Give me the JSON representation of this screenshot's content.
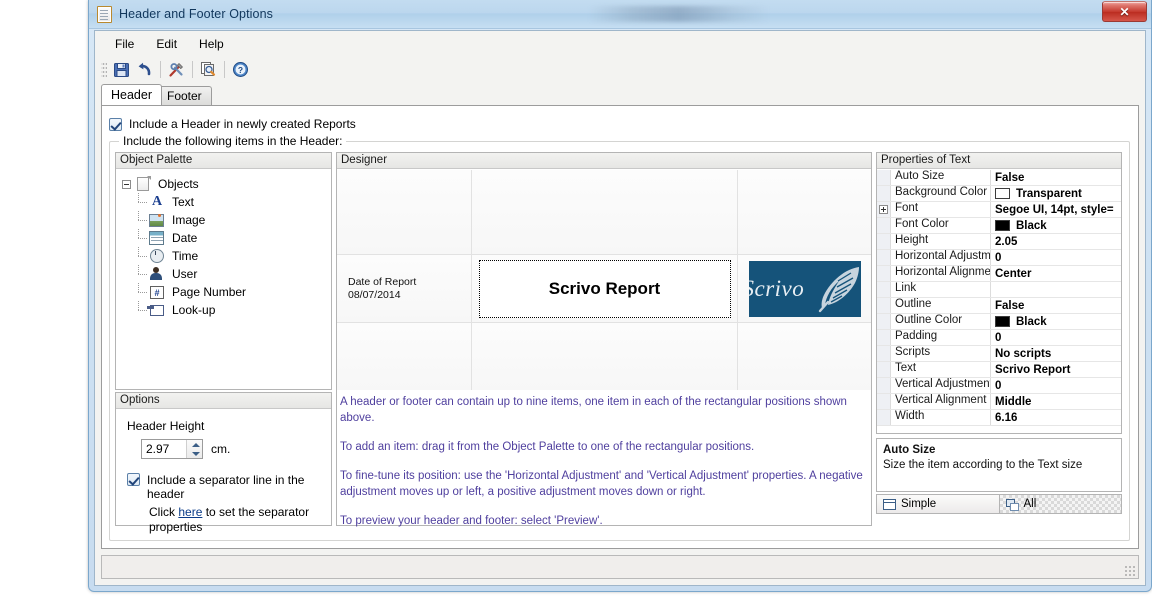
{
  "window": {
    "title": "Header and Footer Options",
    "icon": "document-icon",
    "close_label": "✕"
  },
  "menu": {
    "items": [
      {
        "label": "File"
      },
      {
        "label": "Edit"
      },
      {
        "label": "Help"
      }
    ]
  },
  "toolbar": {
    "buttons": [
      {
        "name": "save-button",
        "icon": "save-icon"
      },
      {
        "name": "undo-button",
        "icon": "undo-icon"
      },
      {
        "name": "tools-button",
        "icon": "tools-icon"
      },
      {
        "name": "preview-button",
        "icon": "preview-icon"
      },
      {
        "name": "help-button",
        "icon": "help-icon"
      }
    ]
  },
  "tabs": [
    {
      "label": "Header",
      "active": true
    },
    {
      "label": "Footer",
      "active": false
    }
  ],
  "content": {
    "include_header_checkbox": {
      "label": "Include a Header in newly created Reports",
      "checked": true
    },
    "group_title": "Include the following items in the Header:"
  },
  "palette": {
    "title": "Object Palette",
    "root": {
      "label": "Objects",
      "icon": "document-icon",
      "expanded": true
    },
    "items": [
      {
        "label": "Text",
        "icon": "text-icon"
      },
      {
        "label": "Image",
        "icon": "image-icon"
      },
      {
        "label": "Date",
        "icon": "date-icon"
      },
      {
        "label": "Time",
        "icon": "time-icon"
      },
      {
        "label": "User",
        "icon": "user-icon"
      },
      {
        "label": "Page Number",
        "icon": "page-number-icon"
      },
      {
        "label": "Look-up",
        "icon": "look-up-icon"
      }
    ]
  },
  "options": {
    "title": "Options",
    "header_height_label": "Header Height",
    "header_height_value": "2.97",
    "header_height_unit": "cm.",
    "separator_checkbox": {
      "label": "Include a separator line in the header",
      "checked": true
    },
    "separator_link_prefix": "Click ",
    "separator_link_text": "here",
    "separator_link_suffix": " to set the separator properties"
  },
  "designer": {
    "title": "Designer",
    "cells": {
      "date_label": "Date of Report",
      "date_value": "08/07/2014",
      "title_text": "Scrivo Report",
      "logo_text": "Scrivo",
      "logo_color": "#15537a",
      "logo_icon": "quill-icon"
    },
    "help": [
      "A header or footer can contain up to nine items, one item in each of the rectangular positions shown above.",
      "To add an item: drag it from the Object Palette to one of the rectangular positions.",
      "To fine-tune its position: use the 'Horizontal Adjustment' and 'Vertical Adjustment' properties. A negative adjustment moves up or left, a positive adjustment moves down or right.",
      "To preview your header and footer: select 'Preview'."
    ],
    "help_color": "#4f3f9e"
  },
  "properties": {
    "title": "Properties of Text",
    "rows": [
      {
        "name": "Auto Size",
        "value": "False",
        "expandable": false
      },
      {
        "name": "Background Color",
        "value": "Transparent",
        "swatch": "#ffffff",
        "expandable": false
      },
      {
        "name": "Font",
        "value": "Segoe UI, 14pt, style=",
        "expandable": true
      },
      {
        "name": "Font Color",
        "value": "Black",
        "swatch": "#000000",
        "expandable": false
      },
      {
        "name": "Height",
        "value": "2.05",
        "expandable": false
      },
      {
        "name": "Horizontal Adjustme",
        "value": "0",
        "expandable": false
      },
      {
        "name": "Horizontal Alignmen",
        "value": "Center",
        "expandable": false
      },
      {
        "name": "Link",
        "value": "",
        "expandable": false
      },
      {
        "name": "Outline",
        "value": "False",
        "expandable": false
      },
      {
        "name": "Outline Color",
        "value": "Black",
        "swatch": "#000000",
        "expandable": false
      },
      {
        "name": "Padding",
        "value": "0",
        "expandable": false
      },
      {
        "name": "Scripts",
        "value": "No scripts",
        "expandable": false
      },
      {
        "name": "Text",
        "value": "Scrivo Report",
        "expandable": false
      },
      {
        "name": "Vertical Adjustment",
        "value": "0",
        "expandable": false
      },
      {
        "name": "Vertical Alignment",
        "value": "Middle",
        "expandable": false
      },
      {
        "name": "Width",
        "value": "6.16",
        "expandable": false
      }
    ],
    "description": {
      "title": "Auto Size",
      "text": "Size the item according to the Text size"
    },
    "view_tabs": [
      {
        "label": "Simple",
        "icon": "simple-view-icon",
        "active": false
      },
      {
        "label": "All",
        "icon": "all-view-icon",
        "active": true
      }
    ]
  }
}
